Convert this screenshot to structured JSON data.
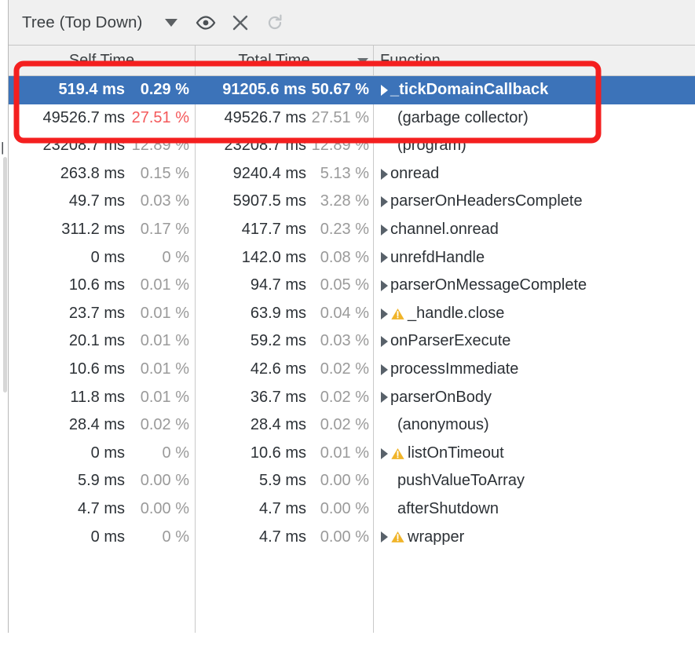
{
  "toolbar": {
    "mode_label": "Tree (Top Down)",
    "caret_icon": "chevron-down-icon",
    "eye_icon": "eye-icon",
    "close_icon": "close-icon",
    "refresh_icon": "refresh-icon"
  },
  "gutter": {
    "tick": "|"
  },
  "table": {
    "columns": [
      {
        "key": "self",
        "label": "Self Time",
        "sorted": false
      },
      {
        "key": "total",
        "label": "Total Time",
        "sorted": true,
        "sort_dir": "desc"
      },
      {
        "key": "func",
        "label": "Function",
        "sorted": false
      }
    ],
    "rows": [
      {
        "self_ms": "519.4 ms",
        "self_pct": "0.29 %",
        "self_pct_hot": false,
        "total_ms": "91205.6 ms",
        "total_pct": "50.67 %",
        "function": "_tickDomainCallback",
        "expandable": true,
        "warning": false,
        "selected": true
      },
      {
        "self_ms": "49526.7 ms",
        "self_pct": "27.51 %",
        "self_pct_hot": true,
        "total_ms": "49526.7 ms",
        "total_pct": "27.51 %",
        "function": "(garbage collector)",
        "expandable": false,
        "warning": false,
        "selected": false
      },
      {
        "self_ms": "23208.7 ms",
        "self_pct": "12.89 %",
        "self_pct_hot": false,
        "total_ms": "23208.7 ms",
        "total_pct": "12.89 %",
        "function": "(program)",
        "expandable": false,
        "warning": false,
        "selected": false
      },
      {
        "self_ms": "263.8 ms",
        "self_pct": "0.15 %",
        "self_pct_hot": false,
        "total_ms": "9240.4 ms",
        "total_pct": "5.13 %",
        "function": "onread",
        "expandable": true,
        "warning": false,
        "selected": false
      },
      {
        "self_ms": "49.7 ms",
        "self_pct": "0.03 %",
        "self_pct_hot": false,
        "total_ms": "5907.5 ms",
        "total_pct": "3.28 %",
        "function": "parserOnHeadersComplete",
        "expandable": true,
        "warning": false,
        "selected": false
      },
      {
        "self_ms": "311.2 ms",
        "self_pct": "0.17 %",
        "self_pct_hot": false,
        "total_ms": "417.7 ms",
        "total_pct": "0.23 %",
        "function": "channel.onread",
        "expandable": true,
        "warning": false,
        "selected": false
      },
      {
        "self_ms": "0 ms",
        "self_pct": "0 %",
        "self_pct_hot": false,
        "total_ms": "142.0 ms",
        "total_pct": "0.08 %",
        "function": "unrefdHandle",
        "expandable": true,
        "warning": false,
        "selected": false
      },
      {
        "self_ms": "10.6 ms",
        "self_pct": "0.01 %",
        "self_pct_hot": false,
        "total_ms": "94.7 ms",
        "total_pct": "0.05 %",
        "function": "parserOnMessageComplete",
        "expandable": true,
        "warning": false,
        "selected": false
      },
      {
        "self_ms": "23.7 ms",
        "self_pct": "0.01 %",
        "self_pct_hot": false,
        "total_ms": "63.9 ms",
        "total_pct": "0.04 %",
        "function": "_handle.close",
        "expandable": true,
        "warning": true,
        "selected": false
      },
      {
        "self_ms": "20.1 ms",
        "self_pct": "0.01 %",
        "self_pct_hot": false,
        "total_ms": "59.2 ms",
        "total_pct": "0.03 %",
        "function": "onParserExecute",
        "expandable": true,
        "warning": false,
        "selected": false
      },
      {
        "self_ms": "10.6 ms",
        "self_pct": "0.01 %",
        "self_pct_hot": false,
        "total_ms": "42.6 ms",
        "total_pct": "0.02 %",
        "function": "processImmediate",
        "expandable": true,
        "warning": false,
        "selected": false
      },
      {
        "self_ms": "11.8 ms",
        "self_pct": "0.01 %",
        "self_pct_hot": false,
        "total_ms": "36.7 ms",
        "total_pct": "0.02 %",
        "function": "parserOnBody",
        "expandable": true,
        "warning": false,
        "selected": false
      },
      {
        "self_ms": "28.4 ms",
        "self_pct": "0.02 %",
        "self_pct_hot": false,
        "total_ms": "28.4 ms",
        "total_pct": "0.02 %",
        "function": "(anonymous)",
        "expandable": false,
        "warning": false,
        "selected": false
      },
      {
        "self_ms": "0 ms",
        "self_pct": "0 %",
        "self_pct_hot": false,
        "total_ms": "10.6 ms",
        "total_pct": "0.01 %",
        "function": "listOnTimeout",
        "expandable": true,
        "warning": true,
        "selected": false
      },
      {
        "self_ms": "5.9 ms",
        "self_pct": "0.00 %",
        "self_pct_hot": false,
        "total_ms": "5.9 ms",
        "total_pct": "0.00 %",
        "function": "pushValueToArray",
        "expandable": false,
        "warning": false,
        "selected": false
      },
      {
        "self_ms": "4.7 ms",
        "self_pct": "0.00 %",
        "self_pct_hot": false,
        "total_ms": "4.7 ms",
        "total_pct": "0.00 %",
        "function": "afterShutdown",
        "expandable": false,
        "warning": false,
        "selected": false
      },
      {
        "self_ms": "0 ms",
        "self_pct": "0 %",
        "self_pct_hot": false,
        "total_ms": "4.7 ms",
        "total_pct": "0.00 %",
        "function": "wrapper",
        "expandable": true,
        "warning": true,
        "selected": false
      }
    ]
  },
  "annotation": {
    "type": "highlight-rectangle",
    "color": "#f41f1f",
    "covers_rows": [
      0,
      1
    ]
  },
  "colors": {
    "selection_blue": "#3c73b9",
    "hot_percent_red": "#f4595b",
    "warning_amber": "#f0b429",
    "toolbar_bg": "#f0f0f0",
    "annotation_red": "#f41f1f"
  }
}
